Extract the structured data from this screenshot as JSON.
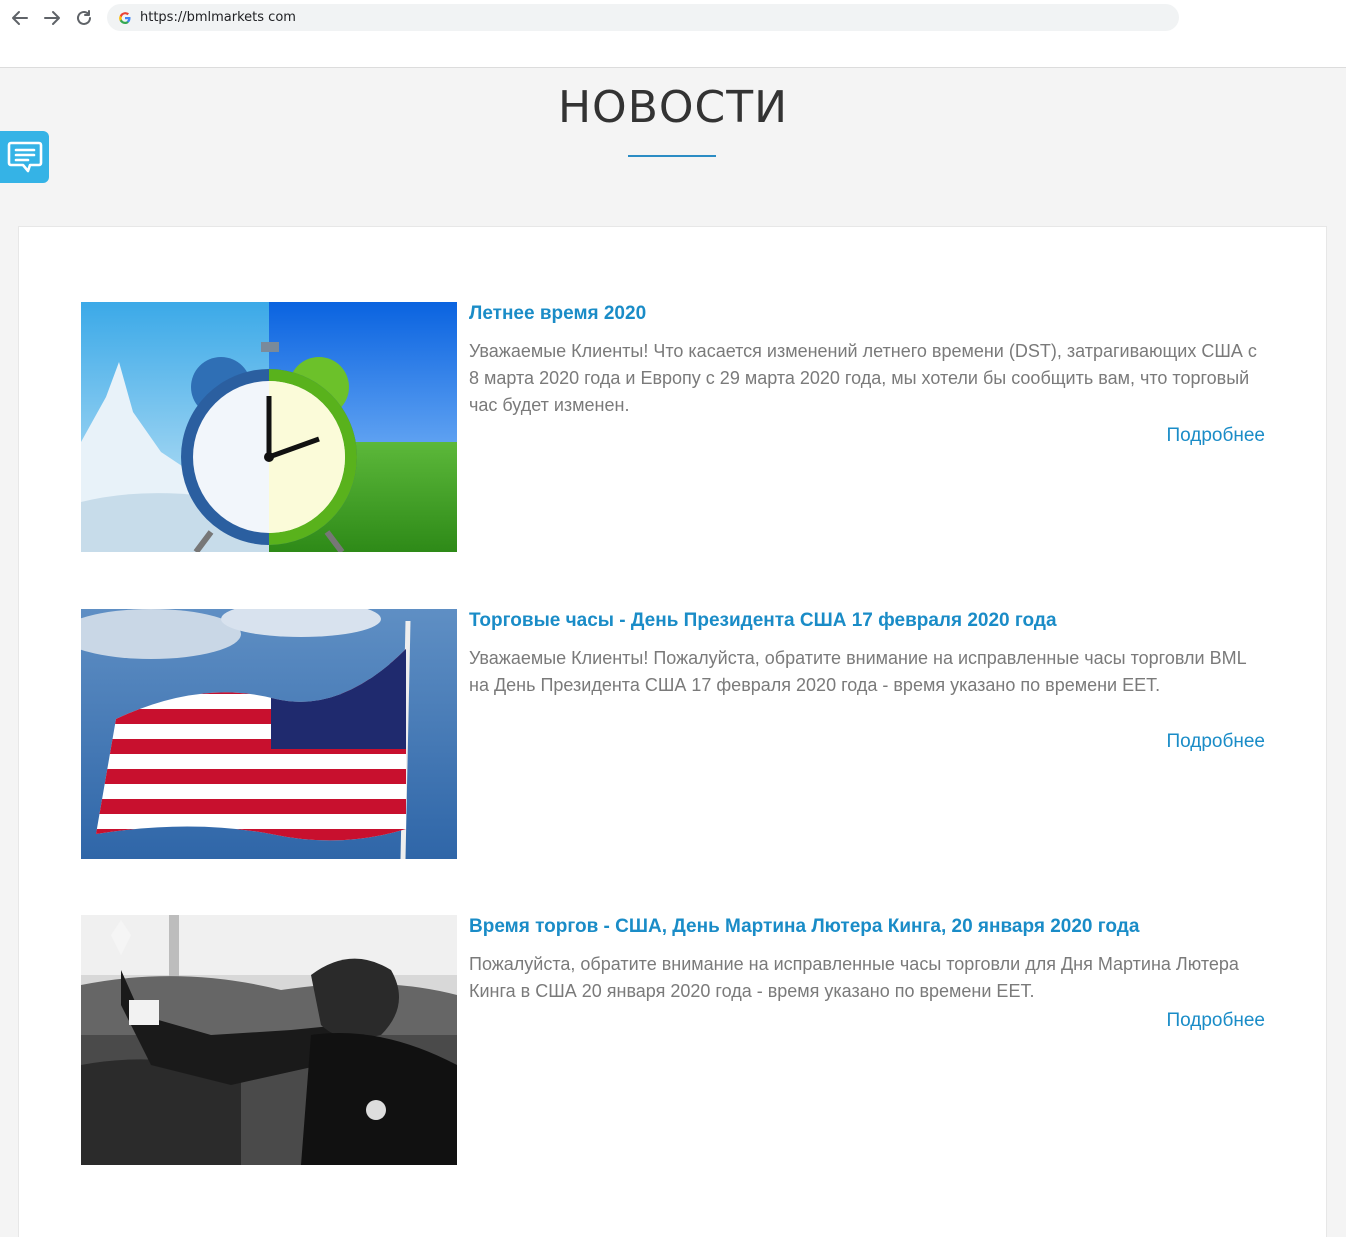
{
  "browser": {
    "url": "https://bmlmarkets com"
  },
  "page": {
    "title": "НОВОСТИ"
  },
  "colors": {
    "accent": "#1a8cc7",
    "chat_widget": "#35b3e6",
    "body_text": "#7a7a7a"
  },
  "news": [
    {
      "title": "Летнее время 2020",
      "description": "Уважаемые Клиенты! Что касается изменений летнего времени (DST), затрагивающих США с 8 марта 2020 года и Европу с 29 марта 2020 года, мы хотели бы сообщить вам, что торговый час будет изменен.",
      "more": "Подробнее",
      "image_icon": "alarm-clock-image"
    },
    {
      "title": "Торговые часы - День Президента США 17 февраля 2020 года",
      "description": "Уважаемые Клиенты! Пожалуйста, обратите внимание на исправленные часы торговли BML на День Президента США 17 февраля 2020 года - время указано по времени EET.",
      "more": "Подробнее",
      "image_icon": "us-flag-image"
    },
    {
      "title": "Время торгов - США, День Мартина Лютера Кинга, 20 января 2020 года",
      "description": "Пожалуйста, обратите внимание на исправленные часы торговли для Дня Мартина Лютера Кинга в США 20 января 2020 года - время указано по времени EET.",
      "more": "Подробнее",
      "image_icon": "mlk-photo-image"
    }
  ]
}
